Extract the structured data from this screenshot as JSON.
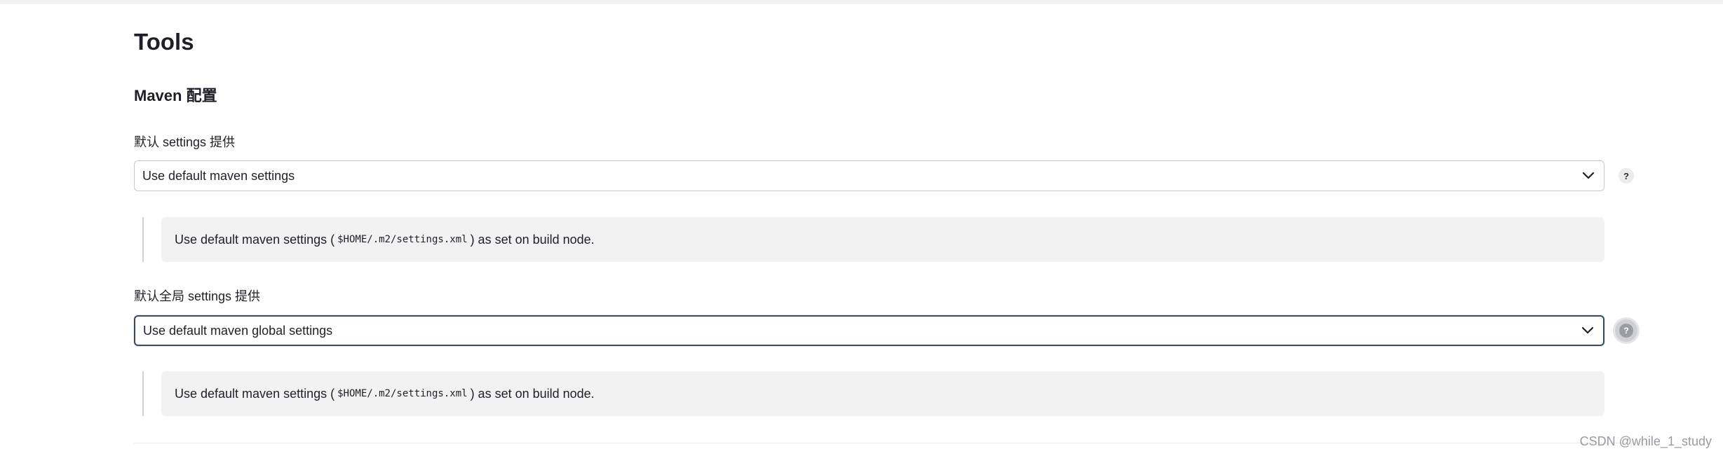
{
  "page": {
    "section_title": "Tools",
    "subsection_title": "Maven 配置"
  },
  "settings_provider": {
    "label": "默认 settings 提供",
    "selected_value": "Use default maven settings",
    "help_label": "?",
    "description": {
      "prefix": "Use default maven settings (",
      "code": "$HOME/.m2/settings.xml",
      "suffix": ") as set on build node."
    }
  },
  "global_settings_provider": {
    "label": "默认全局 settings 提供",
    "selected_value": "Use default maven global settings",
    "help_label": "?",
    "description": {
      "prefix": "Use default maven settings (",
      "code": "$HOME/.m2/settings.xml",
      "suffix": ") as set on build node."
    }
  },
  "watermark": "CSDN @while_1_study",
  "colors": {
    "text": "#1f1f28",
    "description_bg": "#f2f2f3",
    "select_border": "#c5c7cc",
    "select_focus_border": "#3b4a5c"
  },
  "icons": {
    "select_chevron": "chevron-down-icon",
    "help": "question-mark-icon"
  }
}
